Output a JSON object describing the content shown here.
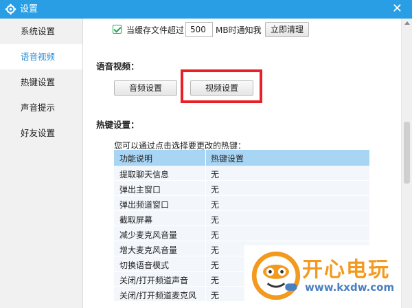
{
  "window": {
    "title": "设置"
  },
  "sidebar": {
    "items": [
      {
        "label": "系统设置",
        "active": false
      },
      {
        "label": "语音视频",
        "active": true
      },
      {
        "label": "热键设置",
        "active": false
      },
      {
        "label": "声音提示",
        "active": false
      },
      {
        "label": "好友设置",
        "active": false
      }
    ]
  },
  "cache": {
    "checked": true,
    "label": "当缓存文件超过",
    "value": "500",
    "unit": "MB时通知我",
    "clear_button": "立即清理"
  },
  "voice_video": {
    "title": "语音视频：",
    "audio_button": "音频设置",
    "video_button": "视频设置"
  },
  "hotkeys": {
    "title": "热键设置：",
    "hint": "您可以通过点击选择要更改的热键：",
    "columns": [
      "功能说明",
      "热键设置"
    ],
    "rows": [
      {
        "name": "提取聊天信息",
        "key": "无"
      },
      {
        "name": "弹出主窗口",
        "key": "无"
      },
      {
        "name": "弹出频道窗口",
        "key": "无"
      },
      {
        "name": "截取屏幕",
        "key": "无"
      },
      {
        "name": "减少麦克风音量",
        "key": "无"
      },
      {
        "name": "增大麦克风音量",
        "key": "无"
      },
      {
        "name": "切换语音模式",
        "key": "无"
      },
      {
        "name": "关闭/打开频道声音",
        "key": "无"
      },
      {
        "name": "关闭/打开频道麦克风",
        "key": "无"
      }
    ]
  },
  "watermark": {
    "title": "开心电玩",
    "url": "www.kxdw.com"
  },
  "colors": {
    "titlebar": "#2a9ee4",
    "active_item": "#2a8fd6",
    "highlight": "#ea2027",
    "table_header": "#a9d5f5",
    "watermark_orange": "#f39a1e",
    "watermark_blue": "#4a7fc1"
  }
}
